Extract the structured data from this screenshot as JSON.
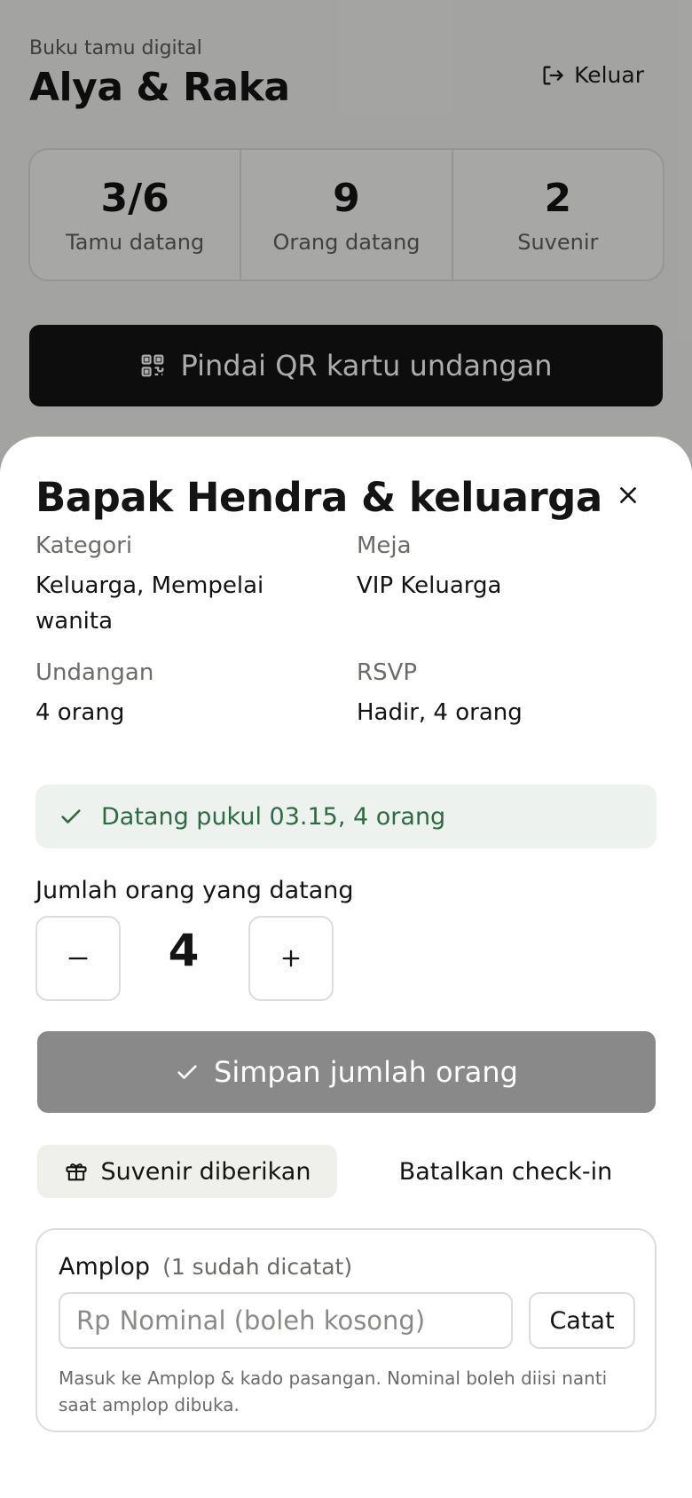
{
  "header": {
    "subtitle": "Buku tamu digital",
    "title": "Alya & Raka",
    "logout_label": "Keluar"
  },
  "stats": [
    {
      "value": "3/6",
      "label": "Tamu datang"
    },
    {
      "value": "9",
      "label": "Orang datang"
    },
    {
      "value": "2",
      "label": "Suvenir"
    }
  ],
  "scan_button_label": "Pindai QR kartu undangan",
  "sheet": {
    "guest_name": "Bapak Hendra & keluarga",
    "category_label": "Kategori",
    "category_value": "Keluarga, Mempelai wanita",
    "table_label": "Meja",
    "table_value": "VIP Keluarga",
    "invited_label": "Undangan",
    "invited_value": "4 orang",
    "rsvp_label": "RSVP",
    "rsvp_value": "Hadir, 4 orang",
    "arrived_text": "Datang pukul 03.15, 4 orang",
    "count_label": "Jumlah orang yang datang",
    "count_value": "4",
    "save_label": "Simpan jumlah orang",
    "souvenir_label": "Suvenir diberikan",
    "cancel_label": "Batalkan check-in",
    "envelope": {
      "title": "Amplop",
      "recorded": "(1 sudah dicatat)",
      "prefix": "Rp",
      "placeholder": "Nominal (boleh kosong)",
      "record_label": "Catat",
      "note": "Masuk ke Amplop & kado pasangan. Nominal boleh diisi nanti saat amplop dibuka."
    }
  },
  "colors": {
    "accent_dark": "#141414",
    "success_bg": "#edf2ee",
    "success_text": "#2e6a43",
    "disabled_button": "#898989"
  }
}
